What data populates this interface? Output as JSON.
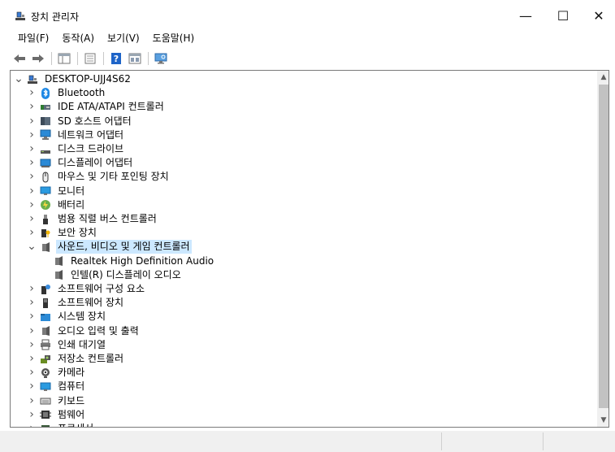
{
  "window": {
    "title": "장치 관리자",
    "min_glyph": "—",
    "max_glyph": "☐",
    "close_glyph": "✕"
  },
  "menu": [
    {
      "label": "파일(F)"
    },
    {
      "label": "동작(A)"
    },
    {
      "label": "보기(V)"
    },
    {
      "label": "도움말(H)"
    }
  ],
  "toolbar": [
    {
      "name": "back-button",
      "icon": "back-arrow-icon"
    },
    {
      "name": "forward-button",
      "icon": "forward-arrow-icon"
    },
    {
      "sep": true
    },
    {
      "name": "show-hide-console-tree-button",
      "icon": "console-tree-icon"
    },
    {
      "sep": true
    },
    {
      "name": "properties-button",
      "icon": "properties-icon"
    },
    {
      "sep": true
    },
    {
      "name": "help-button",
      "icon": "help-icon"
    },
    {
      "name": "view-button",
      "icon": "view-icon"
    },
    {
      "sep": true
    },
    {
      "name": "scan-hardware-button",
      "icon": "monitor-scan-icon"
    }
  ],
  "tree": [
    {
      "label": "DESKTOP-UJJ4S62",
      "level": 0,
      "expander": "expanded",
      "icon": "computer-icon"
    },
    {
      "label": "Bluetooth",
      "level": 1,
      "expander": "collapsed",
      "icon": "bluetooth-icon"
    },
    {
      "label": "IDE ATA/ATAPI 컨트롤러",
      "level": 1,
      "expander": "collapsed",
      "icon": "ide-controller-icon"
    },
    {
      "label": "SD 호스트 어댑터",
      "level": 1,
      "expander": "collapsed",
      "icon": "sd-host-icon"
    },
    {
      "label": "네트워크 어댑터",
      "level": 1,
      "expander": "collapsed",
      "icon": "network-adapter-icon"
    },
    {
      "label": "디스크 드라이브",
      "level": 1,
      "expander": "collapsed",
      "icon": "disk-drive-icon"
    },
    {
      "label": "디스플레이 어댑터",
      "level": 1,
      "expander": "collapsed",
      "icon": "display-adapter-icon"
    },
    {
      "label": "마우스 및 기타 포인팅 장치",
      "level": 1,
      "expander": "collapsed",
      "icon": "mouse-icon"
    },
    {
      "label": "모니터",
      "level": 1,
      "expander": "collapsed",
      "icon": "monitor-icon"
    },
    {
      "label": "배터리",
      "level": 1,
      "expander": "collapsed",
      "icon": "battery-icon"
    },
    {
      "label": "범용 직렬 버스 컨트롤러",
      "level": 1,
      "expander": "collapsed",
      "icon": "usb-icon"
    },
    {
      "label": "보안 장치",
      "level": 1,
      "expander": "collapsed",
      "icon": "security-device-icon"
    },
    {
      "label": "사운드, 비디오 및 게임 컨트롤러",
      "level": 1,
      "expander": "expanded",
      "icon": "speaker-icon",
      "selected": true
    },
    {
      "label": "Realtek High Definition Audio",
      "level": 2,
      "expander": "none",
      "icon": "speaker-icon"
    },
    {
      "label": "인텔(R) 디스플레이 오디오",
      "level": 2,
      "expander": "none",
      "icon": "speaker-icon"
    },
    {
      "label": "소프트웨어 구성 요소",
      "level": 1,
      "expander": "collapsed",
      "icon": "software-component-icon"
    },
    {
      "label": "소프트웨어 장치",
      "level": 1,
      "expander": "collapsed",
      "icon": "software-device-icon"
    },
    {
      "label": "시스템 장치",
      "level": 1,
      "expander": "collapsed",
      "icon": "system-folder-icon"
    },
    {
      "label": "오디오 입력 및 출력",
      "level": 1,
      "expander": "collapsed",
      "icon": "speaker-icon"
    },
    {
      "label": "인쇄 대기열",
      "level": 1,
      "expander": "collapsed",
      "icon": "printer-icon"
    },
    {
      "label": "저장소 컨트롤러",
      "level": 1,
      "expander": "collapsed",
      "icon": "storage-controller-icon"
    },
    {
      "label": "카메라",
      "level": 1,
      "expander": "collapsed",
      "icon": "camera-icon"
    },
    {
      "label": "컴퓨터",
      "level": 1,
      "expander": "collapsed",
      "icon": "monitor-icon"
    },
    {
      "label": "키보드",
      "level": 1,
      "expander": "collapsed",
      "icon": "keyboard-icon"
    },
    {
      "label": "펌웨어",
      "level": 1,
      "expander": "collapsed",
      "icon": "firmware-icon"
    },
    {
      "label": "프로세서",
      "level": 1,
      "expander": "collapsed",
      "icon": "processor-icon"
    }
  ],
  "colors": {
    "selection": "#cce8ff",
    "accent_blue": "#1e88e5",
    "border": "#7a7a7a"
  }
}
